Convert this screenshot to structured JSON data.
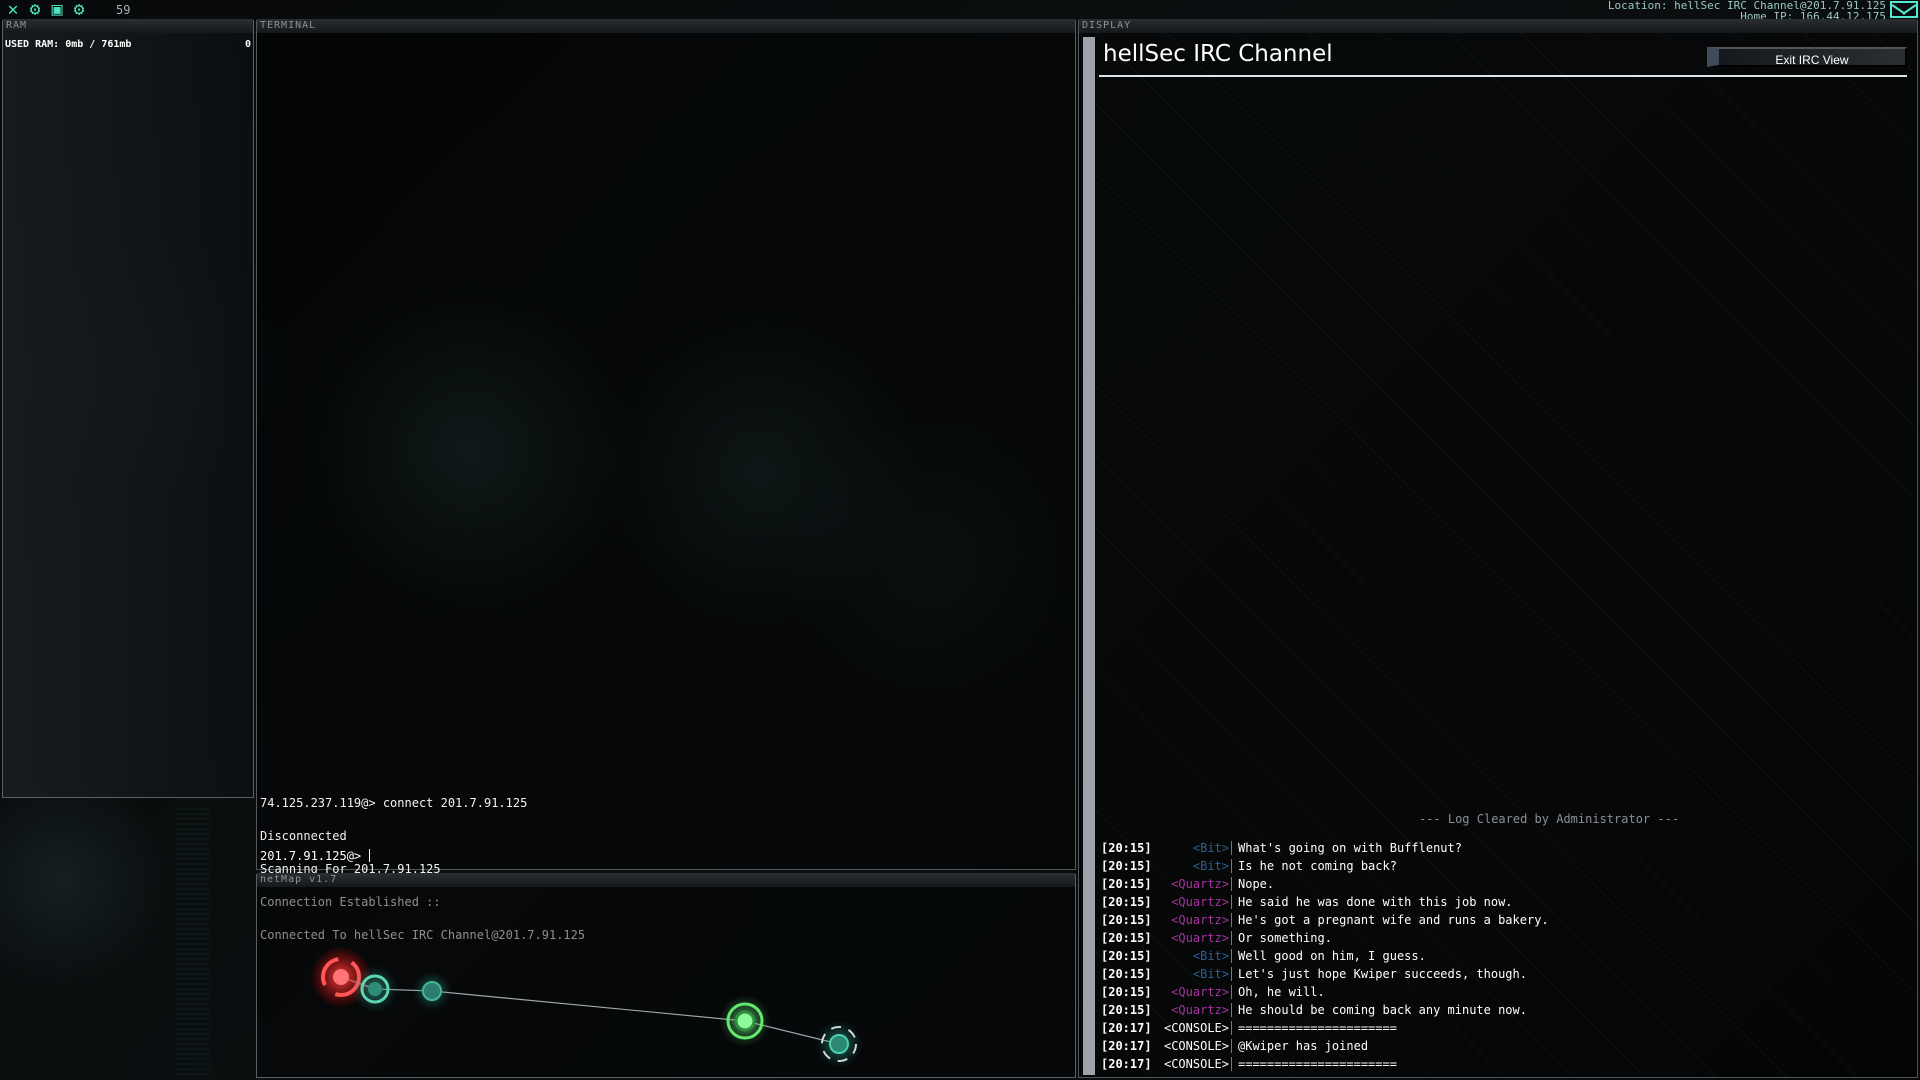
{
  "topbar": {
    "icons": [
      "close-icon",
      "gear-icon",
      "save-icon",
      "settings-icon"
    ],
    "fps": "59",
    "location": "Location: hellSec IRC Channel@201.7.91.125",
    "home_ip": "Home IP: 166.44.12.175",
    "mail_icon": "mail-icon"
  },
  "ram": {
    "label": "RAM",
    "used_label": "USED RAM: 0mb / 761mb",
    "count": "0"
  },
  "terminal": {
    "label": "TERMINAL",
    "lines": [
      "74.125.237.119@> connect 201.7.91.125",
      "Disconnected",
      "Scanning For 201.7.91.125",
      "Connection Established ::",
      "Connected To hellSec IRC Channel@201.7.91.125"
    ],
    "prompt": "201.7.91.125@>"
  },
  "netmap": {
    "label": "netMap v1.7",
    "nodes": [
      {
        "name": "home-node",
        "status": "red"
      },
      {
        "name": "node-2",
        "status": "teal"
      },
      {
        "name": "node-3",
        "status": "teal"
      },
      {
        "name": "connected-node",
        "status": "green"
      },
      {
        "name": "node-5",
        "status": "teal"
      }
    ]
  },
  "display": {
    "label": "DISPLAY",
    "channel_title": "hellSec IRC Channel",
    "exit_button": "Exit IRC View",
    "log_cleared": "--- Log Cleared by Administrator ---",
    "colors": {
      "bit": "#2f5f95",
      "quartz": "#a6339f",
      "console": "#ffffff"
    },
    "messages": [
      {
        "time": "[20:15]",
        "user": "<Bit>",
        "color": "#2f5f95",
        "text": "What's going on with Bufflenut?"
      },
      {
        "time": "[20:15]",
        "user": "<Bit>",
        "color": "#2f5f95",
        "text": "Is he not coming back?"
      },
      {
        "time": "[20:15]",
        "user": "<Quartz>",
        "color": "#a6339f",
        "text": "Nope."
      },
      {
        "time": "[20:15]",
        "user": "<Quartz>",
        "color": "#a6339f",
        "text": "He said he was done with this job now."
      },
      {
        "time": "[20:15]",
        "user": "<Quartz>",
        "color": "#a6339f",
        "text": "He's got a pregnant wife and runs a bakery."
      },
      {
        "time": "[20:15]",
        "user": "<Quartz>",
        "color": "#a6339f",
        "text": "Or something."
      },
      {
        "time": "[20:15]",
        "user": "<Bit>",
        "color": "#2f5f95",
        "text": "Well good on him, I guess."
      },
      {
        "time": "[20:15]",
        "user": "<Bit>",
        "color": "#2f5f95",
        "text": "Let's just hope Kwiper succeeds, though."
      },
      {
        "time": "[20:15]",
        "user": "<Quartz>",
        "color": "#a6339f",
        "text": "Oh, he will."
      },
      {
        "time": "[20:15]",
        "user": "<Quartz>",
        "color": "#a6339f",
        "text": "He should be coming back any minute now."
      },
      {
        "time": "[20:17]",
        "user": "<CONSOLE>",
        "color": "#ffffff",
        "text": "======================"
      },
      {
        "time": "[20:17]",
        "user": "<CONSOLE>",
        "color": "#ffffff",
        "text": "@Kwiper has joined"
      },
      {
        "time": "[20:17]",
        "user": "<CONSOLE>",
        "color": "#ffffff",
        "text": "======================"
      }
    ]
  }
}
